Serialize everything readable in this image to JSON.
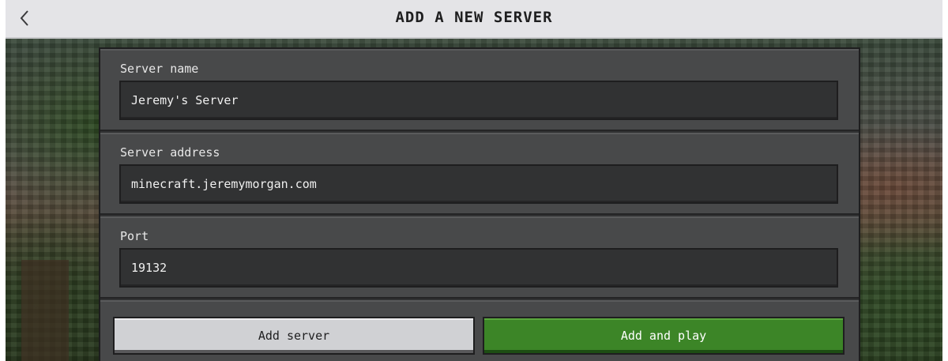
{
  "header": {
    "title": "ADD A NEW SERVER",
    "back_icon": "chevron-left-icon"
  },
  "form": {
    "server_name": {
      "label": "Server name",
      "value": "Jeremy's Server"
    },
    "server_address": {
      "label": "Server address",
      "value": "minecraft.jeremymorgan.com"
    },
    "port": {
      "label": "Port",
      "value": "19132"
    }
  },
  "actions": {
    "add_server_label": "Add server",
    "add_and_play_label": "Add and play"
  },
  "colors": {
    "header_bg": "#e4e4e7",
    "panel_bg": "#48494a",
    "field_bg": "#313233",
    "primary_button": "#3c8527",
    "secondary_button": "#d0d1d4"
  }
}
